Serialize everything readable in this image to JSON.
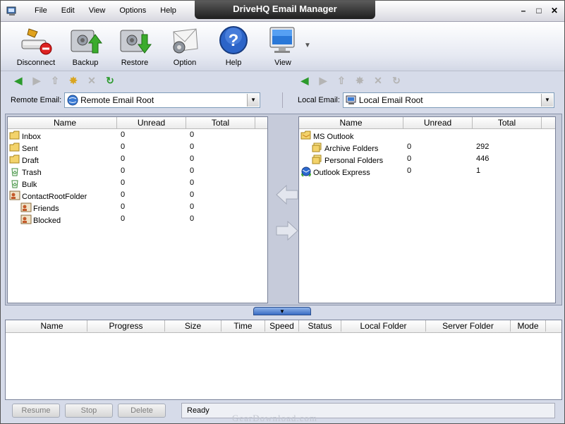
{
  "window": {
    "title": "DriveHQ Email Manager"
  },
  "menu": [
    "File",
    "Edit",
    "View",
    "Options",
    "Help"
  ],
  "window_buttons": {
    "minimize": "–",
    "maximize": "□",
    "close": "✕"
  },
  "toolbar": {
    "disconnect": "Disconnect",
    "backup": "Backup",
    "restore": "Restore",
    "option": "Option",
    "help": "Help",
    "view": "View"
  },
  "remote": {
    "label": "Remote Email:",
    "selected": "Remote Email Root",
    "columns": [
      "Name",
      "Unread",
      "Total"
    ],
    "folders": [
      {
        "name": "Inbox",
        "unread": "0",
        "total": "0",
        "icon": "folder-icon",
        "indent": 0
      },
      {
        "name": "Sent",
        "unread": "0",
        "total": "0",
        "icon": "folder-icon",
        "indent": 0
      },
      {
        "name": "Draft",
        "unread": "0",
        "total": "0",
        "icon": "folder-icon",
        "indent": 0
      },
      {
        "name": "Trash",
        "unread": "0",
        "total": "0",
        "icon": "recycle-icon",
        "indent": 0
      },
      {
        "name": "Bulk",
        "unread": "0",
        "total": "0",
        "icon": "recycle-icon",
        "indent": 0
      },
      {
        "name": "ContactRootFolder",
        "unread": "0",
        "total": "0",
        "icon": "contact-icon",
        "indent": 0
      },
      {
        "name": "Friends",
        "unread": "0",
        "total": "0",
        "icon": "contact-icon",
        "indent": 1
      },
      {
        "name": "Blocked",
        "unread": "0",
        "total": "0",
        "icon": "contact-icon",
        "indent": 1
      }
    ]
  },
  "local": {
    "label": "Local Email:",
    "selected": "Local Email Root",
    "columns": [
      "Name",
      "Unread",
      "Total"
    ],
    "folders": [
      {
        "name": "MS Outlook",
        "unread": "",
        "total": "",
        "icon": "outlook-icon",
        "indent": 0
      },
      {
        "name": "Archive Folders",
        "unread": "0",
        "total": "292",
        "icon": "folder-stack-icon",
        "indent": 1
      },
      {
        "name": "Personal Folders",
        "unread": "0",
        "total": "446",
        "icon": "folder-stack-icon",
        "indent": 1
      },
      {
        "name": "Outlook Express",
        "unread": "0",
        "total": "1",
        "icon": "outlook-express-icon",
        "indent": 0
      }
    ]
  },
  "transfer": {
    "columns": [
      "Name",
      "Progress",
      "Size",
      "Time",
      "Speed",
      "Status",
      "Local Folder",
      "Server Folder",
      "Mode"
    ]
  },
  "bottom": {
    "resume": "Resume",
    "stop": "Stop",
    "delete": "Delete",
    "status": "Ready"
  },
  "watermark": "GearDownload.com"
}
